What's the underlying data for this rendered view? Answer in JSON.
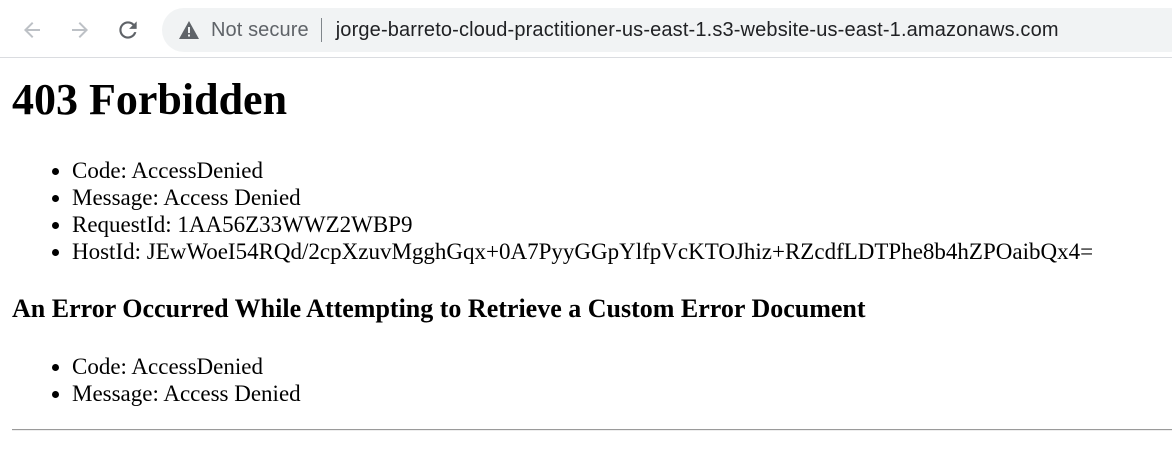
{
  "browser": {
    "security_label": "Not secure",
    "url": "jorge-barreto-cloud-practitioner-us-east-1.s3-website-us-east-1.amazonaws.com",
    "icons": {
      "back": "back-arrow-icon",
      "forward": "forward-arrow-icon",
      "reload": "reload-icon",
      "security": "warning-triangle-icon"
    }
  },
  "page": {
    "title": "403 Forbidden",
    "details": [
      "Code: AccessDenied",
      "Message: Access Denied",
      "RequestId: 1AA56Z33WWZ2WBP9",
      "HostId: JEwWoeI54RQd/2cpXzuvMgghGqx+0A7PyyGGpYlfpVcKTOJhiz+RZcdfLDTPhe8b4hZPOaibQx4="
    ],
    "custom_error": {
      "heading": "An Error Occurred While Attempting to Retrieve a Custom Error Document",
      "details": [
        "Code: AccessDenied",
        "Message: Access Denied"
      ]
    }
  }
}
